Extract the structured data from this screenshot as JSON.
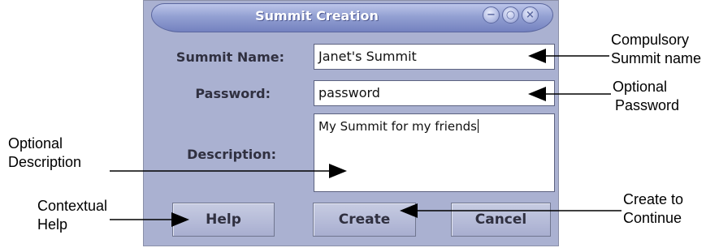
{
  "dialog": {
    "title": "Summit Creation",
    "window_buttons": [
      "minimize-icon",
      "maximize-icon",
      "close-icon"
    ],
    "fields": {
      "summit_name": {
        "label": "Summit Name:",
        "value": "Janet's Summit"
      },
      "password": {
        "label": "Password:",
        "value": "password"
      },
      "description": {
        "label": "Description:",
        "value": "My Summit for my friends"
      }
    },
    "buttons": {
      "help": "Help",
      "create": "Create",
      "cancel": "Cancel"
    }
  },
  "annotations": {
    "summit_name": [
      "Compulsory",
      "Summit name"
    ],
    "password": [
      "Optional",
      "Password"
    ],
    "description": [
      "Optional",
      "Description"
    ],
    "help": [
      "Contextual",
      "Help"
    ],
    "create": [
      "Create to",
      "Continue"
    ]
  },
  "colors": {
    "window_bg": "#aab1d1",
    "titlebar": "#8b98cf",
    "text": "#303040"
  }
}
